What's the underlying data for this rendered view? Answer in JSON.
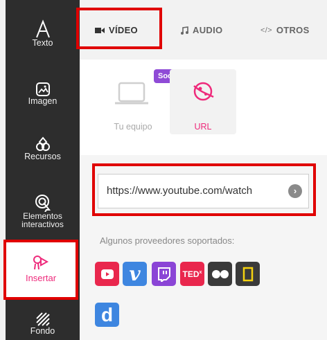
{
  "sidebar": {
    "items": [
      {
        "label": "Texto",
        "icon": "text-icon"
      },
      {
        "label": "Imagen",
        "icon": "image-icon"
      },
      {
        "label": "Recursos",
        "icon": "resources-icon"
      },
      {
        "label": "Elementos\ninteractivos",
        "icon": "interactive-elements-icon"
      },
      {
        "label": "Insertar",
        "icon": "insert-icon"
      },
      {
        "label": "Fondo",
        "icon": "background-icon"
      }
    ]
  },
  "tabs": [
    {
      "label": "VÍDEO",
      "icon": "video-camera-icon"
    },
    {
      "label": "AUDIO",
      "icon": "music-note-icon"
    },
    {
      "label": "OTROS",
      "icon": "code-icon"
    }
  ],
  "sources": {
    "computer": {
      "label": "Tu equipo",
      "badge": "Soon"
    },
    "url": {
      "label": "URL"
    }
  },
  "url_input": {
    "value": "https://www.youtube.com/watch"
  },
  "providers": {
    "label": "Algunos proveedores soportados:",
    "items": [
      "youtube",
      "vimeo",
      "twitch",
      "ted",
      "flickr",
      "national-geographic",
      "dailymotion"
    ]
  },
  "colors": {
    "accent": "#ee2a7b",
    "highlight": "#e00000",
    "soon_badge": "#8f4bd6",
    "provider_red": "#e9274d",
    "provider_blue": "#3e86e0",
    "provider_purple": "#8b45d6",
    "provider_dark": "#3a3a3a"
  }
}
